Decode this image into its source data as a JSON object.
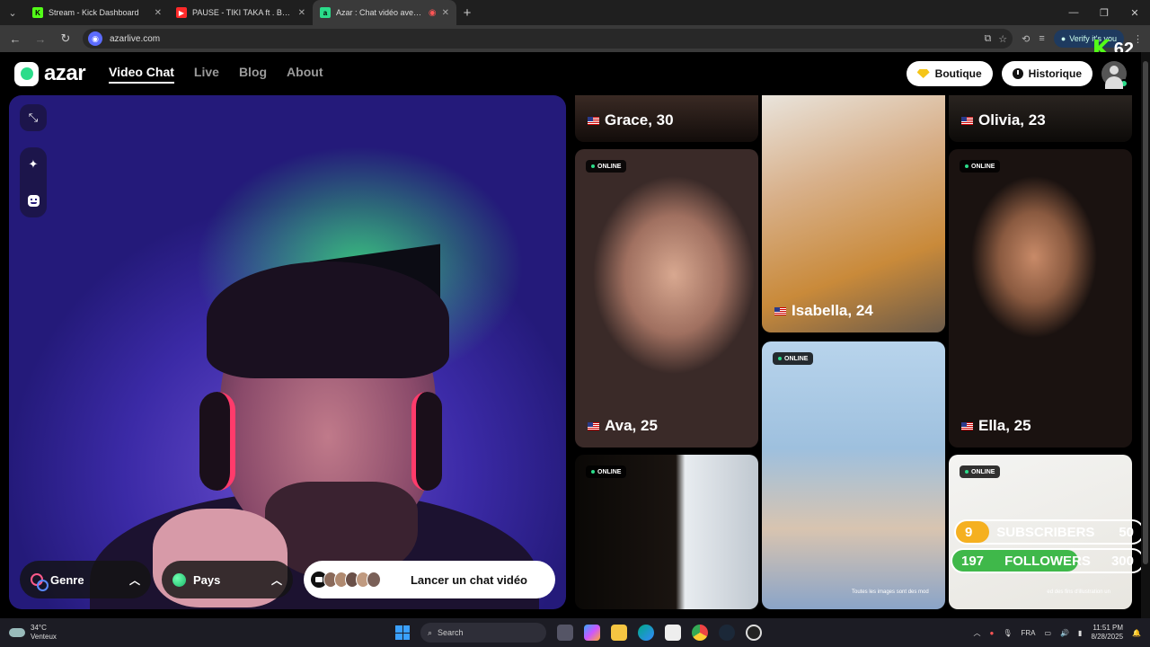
{
  "browser": {
    "tabs": [
      {
        "title": "Stream - Kick Dashboard",
        "favicon": "K",
        "favicon_color": "#53fc18",
        "active": false
      },
      {
        "title": "PAUSE - TIKI TAKA ft . BERMUDA",
        "favicon": "▶",
        "favicon_color": "#ff2a2a",
        "active": false
      },
      {
        "title": "Azar : Chat vidéo avec de n",
        "favicon": "a",
        "favicon_color": "#2bdc8a",
        "active": true
      }
    ],
    "url": "azarlive.com",
    "verify_label": "Verify it's you"
  },
  "stream_overlay": {
    "kick_letter": "K",
    "viewer_count": "62",
    "subscribers": {
      "current": "9",
      "label": "SUBSCRIBERS",
      "goal": "50",
      "progress": 0.18
    },
    "followers": {
      "current": "197",
      "label": "FOLLOWERS",
      "goal": "300",
      "progress": 0.66
    }
  },
  "site": {
    "logo_text": "azar",
    "nav": [
      {
        "label": "Video Chat",
        "active": true
      },
      {
        "label": "Live",
        "active": false
      },
      {
        "label": "Blog",
        "active": false
      },
      {
        "label": "About",
        "active": false
      }
    ],
    "shop_label": "Boutique",
    "history_label": "Historique",
    "accent_color": "#2bdc8a"
  },
  "camera_panel": {
    "gender_filter": "Genre",
    "country_filter": "Pays",
    "start_label": "Lancer un chat vidéo"
  },
  "profiles": [
    {
      "name": "Grace, 30",
      "online": false
    },
    {
      "name": "Olivia, 23",
      "online": false
    },
    {
      "name": "Isabella, 24",
      "online": false
    },
    {
      "name": "Ava, 25",
      "online": true
    },
    {
      "name": "Ella, 25",
      "online": true
    },
    {
      "name": "",
      "online": true
    },
    {
      "name": "",
      "online": true
    },
    {
      "name": "",
      "online": true
    }
  ],
  "online_label": "ONLINE",
  "disclaimer": "Toutes les images sont des mod",
  "disclaimer_tail": "ed des fins d'illustration un",
  "taskbar": {
    "temperature": "34°C",
    "weather": "Venteux",
    "search_label": "Search",
    "language": "FRA",
    "time": "11:51 PM",
    "date": "8/28/2025"
  }
}
